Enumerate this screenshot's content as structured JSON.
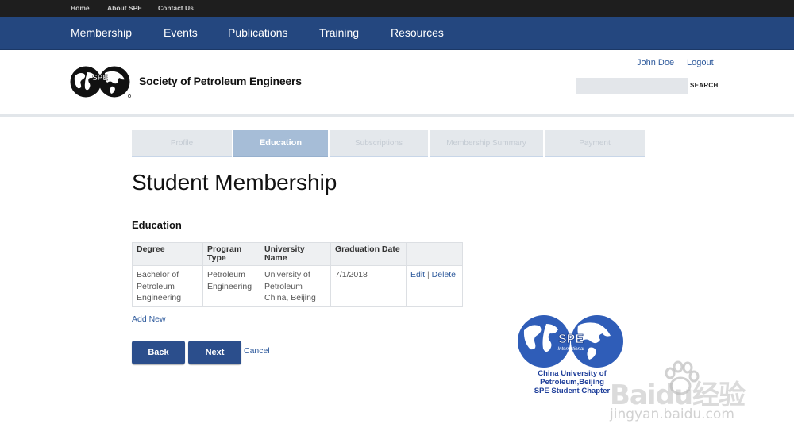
{
  "topbar": {
    "links": [
      "Home",
      "About SPE",
      "Contact Us"
    ]
  },
  "mainnav": {
    "items": [
      "Membership",
      "Events",
      "Publications",
      "Training",
      "Resources"
    ]
  },
  "header": {
    "org_name": "Society of Petroleum Engineers",
    "logo_text": "SPE",
    "user_name": "John Doe",
    "logout_label": "Logout",
    "search_placeholder": "",
    "search_button": "SEARCH"
  },
  "steps": {
    "items": [
      "Profile",
      "Education",
      "Subscriptions",
      "Membership Summary",
      "Payment"
    ],
    "active": "Education"
  },
  "page": {
    "title": "Student Membership",
    "section_title": "Education"
  },
  "table": {
    "headers": [
      "Degree",
      "Program Type",
      "University Name",
      "Graduation Date",
      ""
    ],
    "rows": [
      {
        "degree": "Bachelor of Petroleum Engineering",
        "program_type": "Petroleum Engineering",
        "university": "University of Petroleum China, Beijing",
        "graduation_date": "7/1/2018",
        "edit_label": "Edit",
        "separator": "|",
        "delete_label": "Delete"
      }
    ]
  },
  "actions": {
    "add_new": "Add New",
    "back": "Back",
    "next": "Next",
    "cancel": "Cancel"
  },
  "chapter": {
    "logo_text": "SPE",
    "logo_subtext": "International",
    "name_line1": "China University of",
    "name_line2": "Petroleum,Beijing",
    "name_line3": "SPE Student Chapter"
  },
  "watermark": {
    "logo": "Baidu经验",
    "url": "jingyan.baidu.com"
  },
  "colors": {
    "nav_blue": "#24477f",
    "button_blue": "#2b4e8c",
    "link_blue": "#2e5a9c",
    "active_step": "#a6bdd7"
  }
}
